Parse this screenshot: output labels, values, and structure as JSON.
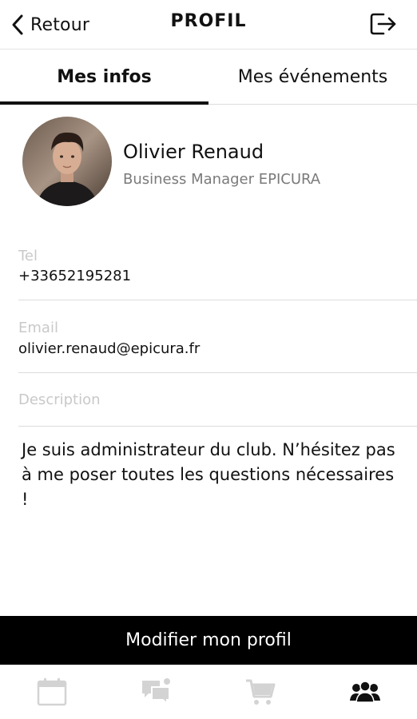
{
  "header": {
    "back_label": "Retour",
    "title": "PROFIL",
    "logout_icon": "logout-icon"
  },
  "tabs": [
    {
      "label": "Mes infos",
      "active": true
    },
    {
      "label": "Mes événements",
      "active": false
    }
  ],
  "profile": {
    "name": "Olivier Renaud",
    "role": "Business Manager EPICURA"
  },
  "fields": {
    "tel_label": "Tel",
    "tel_value": "+33652195281",
    "email_label": "Email",
    "email_value": "olivier.renaud@epicura.fr",
    "description_label": "Description",
    "description_value": "Je suis administrateur du club. N’hésitez pas à me poser toutes les questions nécessaires !"
  },
  "actions": {
    "edit_label": "Modifier mon profil"
  },
  "bottom_nav": [
    {
      "icon": "calendar-icon",
      "active": false
    },
    {
      "icon": "chat-icon",
      "active": false
    },
    {
      "icon": "cart-icon",
      "active": false
    },
    {
      "icon": "users-icon",
      "active": true
    }
  ],
  "colors": {
    "primary": "#000000",
    "muted_label": "#c9c9c9",
    "subtitle": "#7a7a7a",
    "inactive_icon": "#d3d3d3"
  }
}
